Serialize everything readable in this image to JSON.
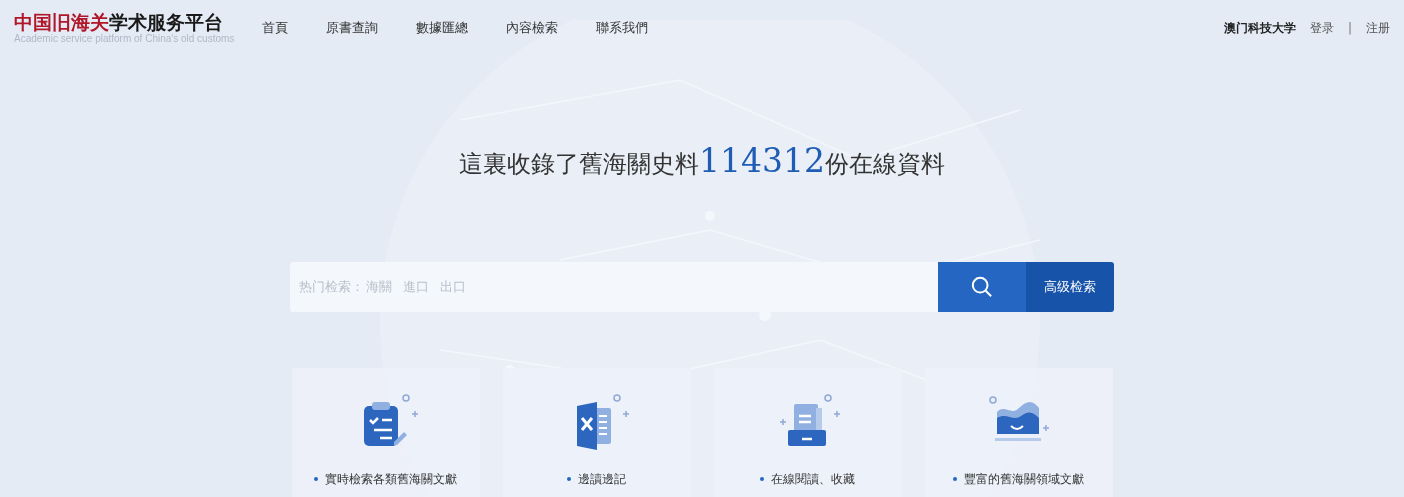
{
  "logo": {
    "title_red": "中国旧海关",
    "title_black": "学术服务平台",
    "subtitle": "Academic service platform of China's old customs"
  },
  "nav": [
    {
      "label": "首頁"
    },
    {
      "label": "原書查詢"
    },
    {
      "label": "數據匯總"
    },
    {
      "label": "內容檢索"
    },
    {
      "label": "聯系我們"
    }
  ],
  "account": {
    "institution": "澳门科技大学",
    "login": "登录",
    "separator": "|",
    "register": "注册"
  },
  "headline": {
    "prefix": "這裏收錄了舊海關史料",
    "count": "114312",
    "suffix": "份在線資料"
  },
  "search": {
    "hot_label": "热门检索：",
    "keywords": [
      "海關",
      "進口",
      "出口"
    ],
    "advanced_button": "高级检索"
  },
  "features": [
    {
      "kind": "clipboard",
      "text": "實時檢索各類舊海關文獻"
    },
    {
      "kind": "spreadsheet",
      "text": "邊讀邊記"
    },
    {
      "kind": "tray",
      "text": "在線閱讀、收藏"
    },
    {
      "kind": "chart",
      "text": "豐富的舊海關領域文獻"
    }
  ]
}
